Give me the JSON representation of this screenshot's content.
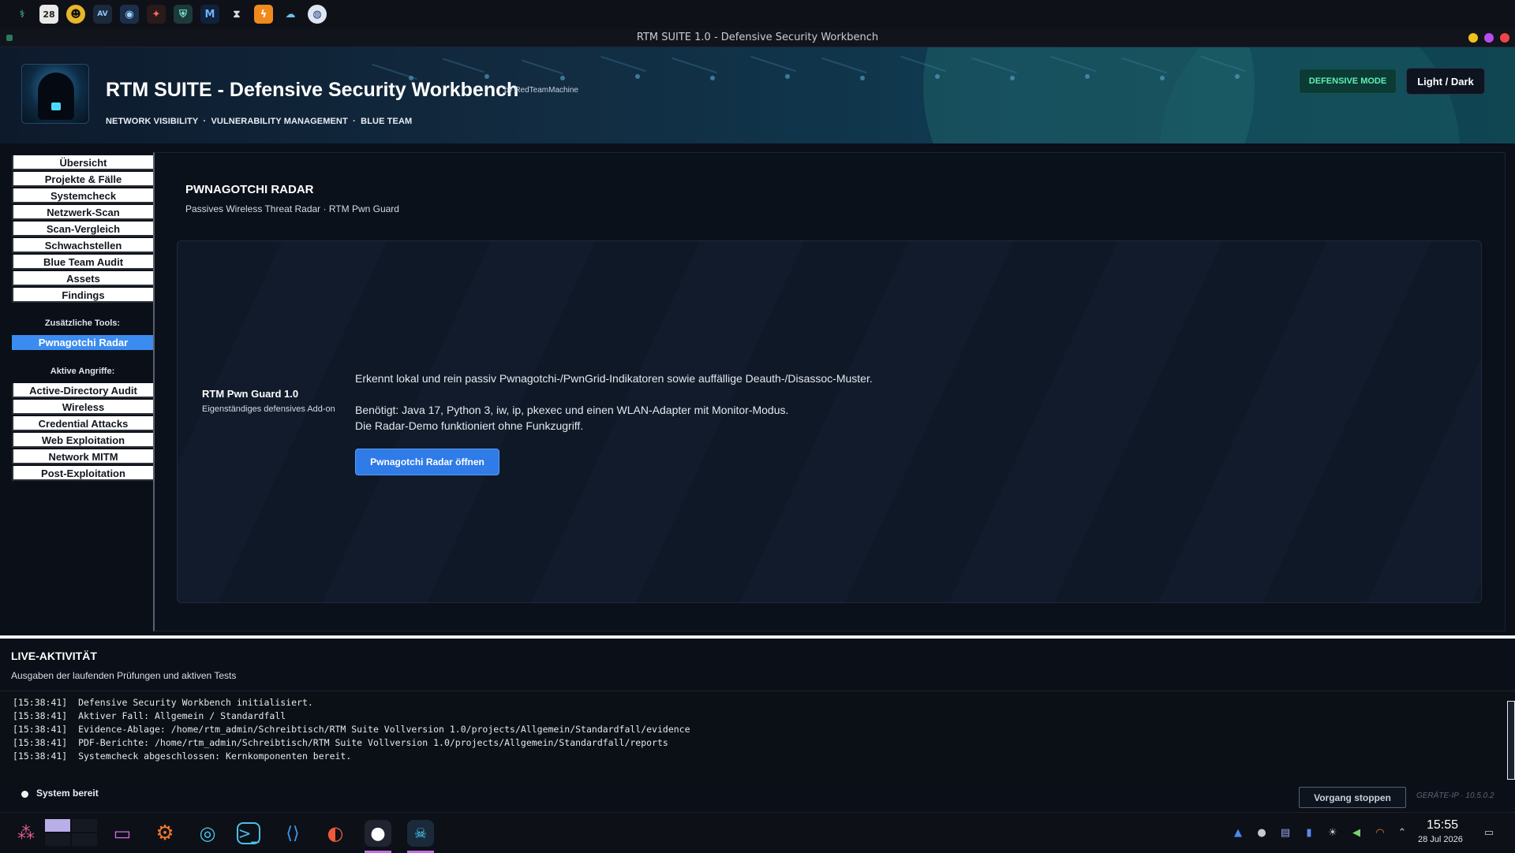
{
  "window": {
    "title": "RTM SUITE 1.0 - Defensive Security Workbench"
  },
  "header": {
    "title": "RTM SUITE - Defensive Security Workbench",
    "by": "by RedTeamMachine",
    "tags": "NETWORK VISIBILITY  ·  VULNERABILITY MANAGEMENT  ·  BLUE TEAM",
    "mode_badge": "DEFENSIVE MODE",
    "theme_button": "Light / Dark"
  },
  "sidebar": {
    "main_items": [
      "Übersicht",
      "Projekte & Fälle",
      "Systemcheck",
      "Netzwerk-Scan",
      "Scan-Vergleich",
      "Schwachstellen",
      "Blue Team Audit",
      "Assets",
      "Findings"
    ],
    "extra_heading": "Zusätzliche Tools:",
    "extra_items": [
      "Pwnagotchi Radar"
    ],
    "active_item": "Pwnagotchi Radar",
    "attack_heading": "Aktive Angriffe:",
    "attack_items": [
      "Active-Directory Audit",
      "Wireless",
      "Credential Attacks",
      "Web Exploitation",
      "Network MITM",
      "Post-Exploitation"
    ]
  },
  "main": {
    "title": "PWNAGOTCHI RADAR",
    "subtitle": "Passives Wireless Threat Radar · RTM Pwn Guard",
    "card": {
      "name": "RTM Pwn Guard 1.0",
      "caption": "Eigenständiges defensives Add-on",
      "line1": "Erkennt lokal und rein passiv Pwnagotchi-/PwnGrid-Indikatoren sowie auffällige Deauth-/Disassoc-Muster.",
      "line2": "Benötigt: Java 17, Python 3, iw, ip, pkexec und einen WLAN-Adapter mit Monitor-Modus.",
      "line3": "Die Radar-Demo funktioniert ohne Funkzugriff.",
      "button": "Pwnagotchi Radar öffnen"
    }
  },
  "live": {
    "title": "LIVE-AKTIVITÄT",
    "subtitle": "Ausgaben der laufenden Prüfungen und aktiven Tests",
    "log": [
      "[15:38:41]  Defensive Security Workbench initialisiert.",
      "[15:38:41]  Aktiver Fall: Allgemein / Standardfall",
      "[15:38:41]  Evidence-Ablage: /home/rtm_admin/Schreibtisch/RTM Suite Vollversion 1.0/projects/Allgemein/Standardfall/evidence",
      "[15:38:41]  PDF-Berichte: /home/rtm_admin/Schreibtisch/RTM Suite Vollversion 1.0/projects/Allgemein/Standardfall/reports",
      "[15:38:41]  Systemcheck abgeschlossen: Kernkomponenten bereit."
    ],
    "status": "System bereit",
    "stop_button": "Vorgang stoppen",
    "device_ip": "GERÄTE-IP · 10.5.0.2"
  },
  "taskbar": {
    "time": "15:55",
    "date": "28 Jul 2026"
  },
  "system_tray_top": {
    "calendar_day": "28"
  },
  "colors": {
    "accent": "#3b8cf0",
    "mode_badge_text": "#5ff0b4",
    "window_dot_yellow": "#f2c21b",
    "window_dot_purple": "#b84ef0",
    "window_dot_red": "#f0444a"
  },
  "icons": [
    "radar-app-icon",
    "calendar-icon",
    "alien-icon",
    "antivirus-icon",
    "ghost-icon",
    "wand-icon",
    "shield-icon",
    "malwarebytes-icon",
    "timer-icon",
    "bolt-icon",
    "cloud-icon",
    "globe-icon",
    "app-launcher-icon",
    "folder-icon",
    "settings-icon",
    "browser-icon",
    "terminal-icon",
    "vscode-icon",
    "firefox-icon",
    "github-icon",
    "rtm-app-icon"
  ]
}
